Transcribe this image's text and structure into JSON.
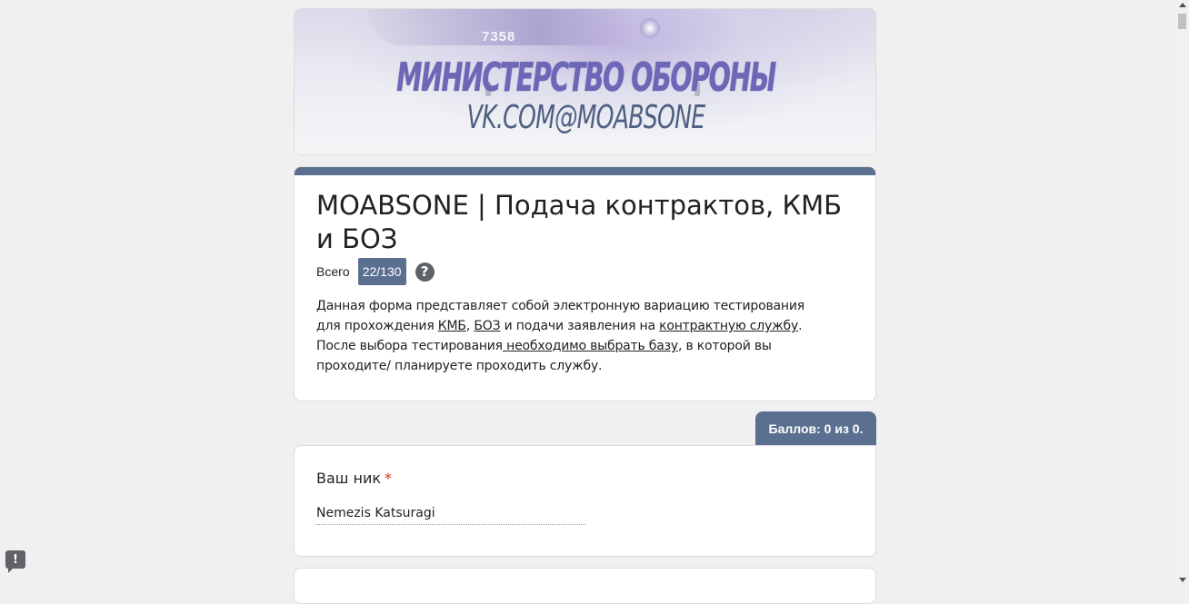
{
  "banner": {
    "aircraft_number": "7358",
    "logo_line1": "МИНИСТЕРСТВО ОБОРОНЫ",
    "logo_line2": "VK.COM@MOABSONE"
  },
  "form": {
    "title": "MOABSONE | Подача контрактов, КМБ и БОЗ",
    "total_label": "Всего",
    "total_value": "22/130",
    "help_icon": "question-icon",
    "description": {
      "p1_a": "Данная форма представляет собой электронную вариацию тестирования для прохождения ",
      "link_kmb": "КМБ",
      "p1_b": ", ",
      "link_boz": "БОЗ",
      "p1_c": " и подачи заявления на ",
      "link_contract": "контрактную службу",
      "p1_d": ".",
      "p2_a": "После выбора тестирования",
      "link_base": " необходимо выбрать базу",
      "p2_b": ", в которой вы проходите/ планируете проходить службу."
    }
  },
  "score": {
    "label": "Баллов: 0 из 0."
  },
  "question": {
    "label": "Ваш ник",
    "required_mark": "*",
    "answer": "Nemezis Katsuragi"
  },
  "report_button": {
    "icon": "report-icon",
    "label": "!"
  },
  "colors": {
    "accent": "#5b7090",
    "background": "#f0f0f0",
    "required": "#d93025"
  }
}
